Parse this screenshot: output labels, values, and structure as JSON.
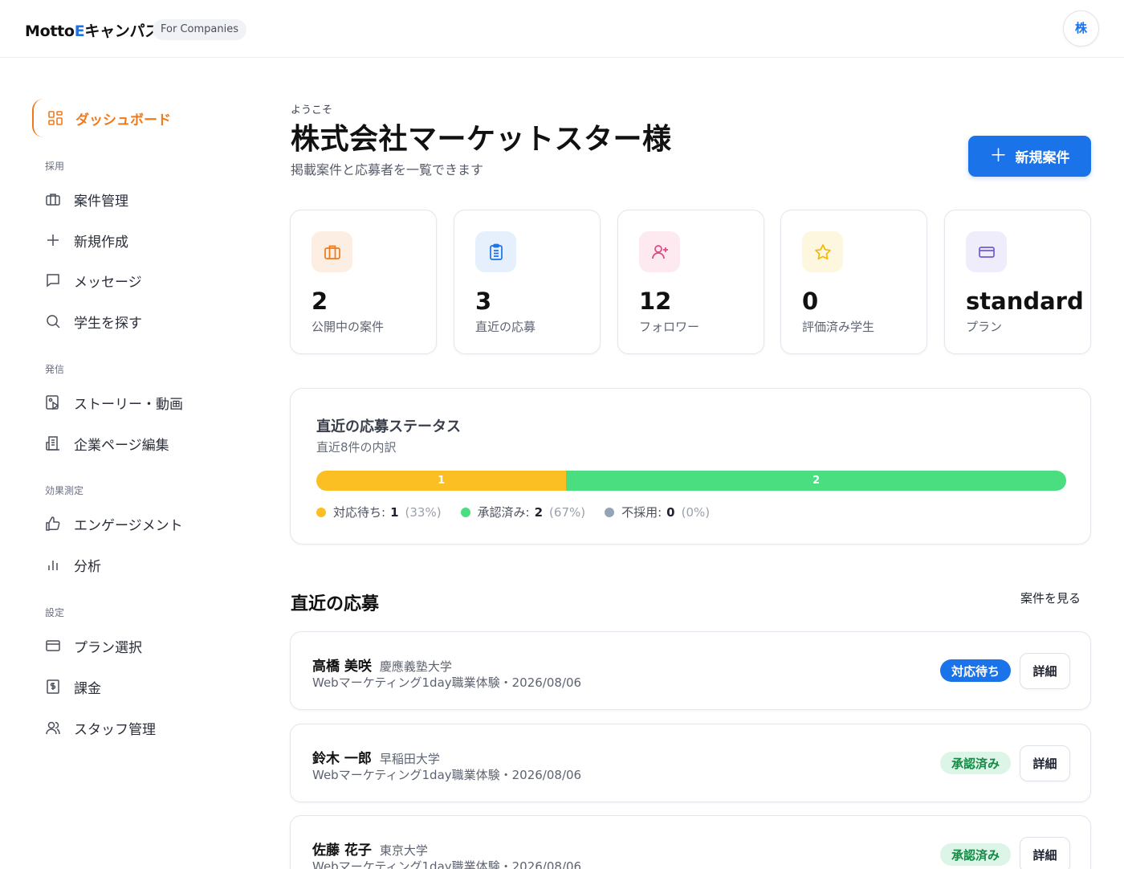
{
  "header": {
    "logo_prefix": "Motto",
    "logo_accent": "E",
    "logo_suffix": "キャンパス",
    "badge": "For Companies",
    "avatar_initial": "株"
  },
  "sidebar": {
    "active_item": {
      "label": "ダッシュボード",
      "icon": "dashboard-grid-icon"
    },
    "sections": [
      {
        "label": "採用",
        "items": [
          {
            "label": "案件管理",
            "icon": "briefcase-icon"
          },
          {
            "label": "新規作成",
            "icon": "plus-icon"
          },
          {
            "label": "メッセージ",
            "icon": "message-icon"
          },
          {
            "label": "学生を探す",
            "icon": "search-icon"
          }
        ]
      },
      {
        "label": "発信",
        "items": [
          {
            "label": "ストーリー・動画",
            "icon": "image-video-icon"
          },
          {
            "label": "企業ページ編集",
            "icon": "building-icon"
          }
        ]
      },
      {
        "label": "効果測定",
        "items": [
          {
            "label": "エンゲージメント",
            "icon": "thumbs-up-icon"
          },
          {
            "label": "分析",
            "icon": "bar-chart-icon"
          }
        ]
      },
      {
        "label": "設定",
        "items": [
          {
            "label": "プラン選択",
            "icon": "credit-card-icon"
          },
          {
            "label": "課金",
            "icon": "receipt-icon"
          },
          {
            "label": "スタッフ管理",
            "icon": "users-icon"
          }
        ]
      }
    ]
  },
  "main": {
    "welcome": "ようこそ",
    "company_title": "株式会社マーケットスター様",
    "subtitle": "掲載案件と応募者を一覧できます",
    "new_button_label": "新規案件",
    "stats": [
      {
        "value": "2",
        "label": "公開中の案件",
        "icon": "briefcase-icon",
        "color": "#f07a1a",
        "bg": "#fdeee3"
      },
      {
        "value": "3",
        "label": "直近の応募",
        "icon": "clipboard-icon",
        "color": "#1a73e8",
        "bg": "#e6f0fd"
      },
      {
        "value": "12",
        "label": "フォロワー",
        "icon": "user-plus-icon",
        "color": "#e2457f",
        "bg": "#fde9f0"
      },
      {
        "value": "0",
        "label": "評価済み学生",
        "icon": "star-icon",
        "color": "#f5b800",
        "bg": "#fef7e0"
      },
      {
        "value": "standard",
        "label": "プラン",
        "icon": "credit-card-icon",
        "color": "#6d5bd6",
        "bg": "#efedfc"
      }
    ],
    "status": {
      "title": "直近の応募ステータス",
      "subtitle": "直近8件の内訳",
      "segments": [
        {
          "label": "対応待ち:",
          "count": 1,
          "percent": "(33%)",
          "share": 0.3333,
          "color": "#fbbf24"
        },
        {
          "label": "承認済み:",
          "count": 2,
          "percent": "(67%)",
          "share": 0.6667,
          "color": "#4ade80"
        },
        {
          "label": "不採用:",
          "count": 0,
          "percent": "(0%)",
          "share": 0,
          "color": "#94a3b8"
        }
      ]
    },
    "recent": {
      "title": "直近の応募",
      "view_link": "案件を見る",
      "detail_label": "詳細",
      "items": [
        {
          "name": "高橋 美咲",
          "school": "慶應義塾大学",
          "detail": "Webマーケティング1day職業体験・2026/08/06",
          "status": "対応待ち",
          "status_type": "pending"
        },
        {
          "name": "鈴木 一郎",
          "school": "早稲田大学",
          "detail": "Webマーケティング1day職業体験・2026/08/06",
          "status": "承認済み",
          "status_type": "approved"
        },
        {
          "name": "佐藤 花子",
          "school": "東京大学",
          "detail": "Webマーケティング1day職業体験・2026/08/06",
          "status": "承認済み",
          "status_type": "approved"
        }
      ]
    }
  }
}
